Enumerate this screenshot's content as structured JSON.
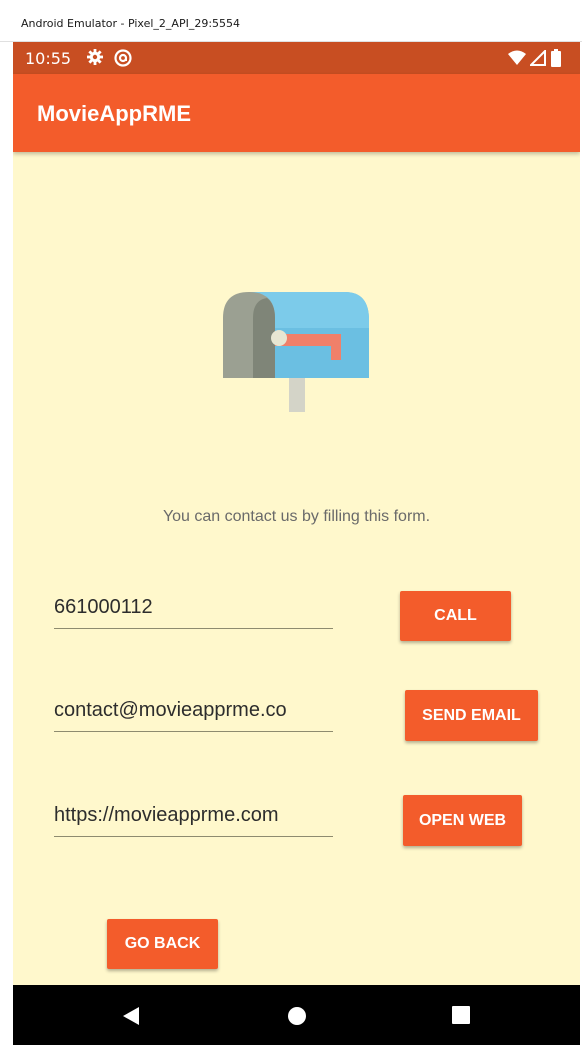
{
  "window": {
    "title": "Android Emulator - Pixel_2_API_29:5554"
  },
  "statusbar": {
    "time": "10:55",
    "left_icons": [
      "gear-icon",
      "at-sign-icon"
    ],
    "right_icons": [
      "wifi-icon",
      "signal-icon",
      "battery-icon"
    ]
  },
  "appbar": {
    "title": "MovieAppRME"
  },
  "hero": {
    "icon": "mailbox-icon"
  },
  "content": {
    "message": "You can contact us by filling this form."
  },
  "form": {
    "phone": {
      "value": "661000112",
      "button": "CALL"
    },
    "email": {
      "value": "contact@movieapprme.co",
      "button": "SEND EMAIL"
    },
    "web": {
      "value": "https://movieapprme.com",
      "button": "OPEN WEB"
    }
  },
  "footer": {
    "back_button": "GO BACK"
  },
  "navbar": {
    "icons": [
      "back-icon",
      "home-icon",
      "recents-icon"
    ]
  },
  "colors": {
    "primary": "#f35c2b",
    "primary_dark": "#c84e22",
    "background": "#fff8cc",
    "navbar": "#000000"
  }
}
